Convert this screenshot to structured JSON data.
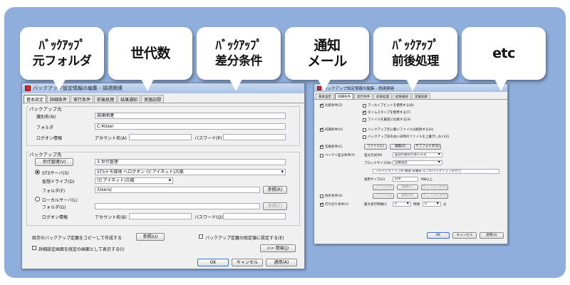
{
  "callouts": [
    {
      "line1": "ﾊﾞｯｸｱｯﾌﾟ",
      "line2": "元フォルダ"
    },
    {
      "line1": "世代数",
      "line2": ""
    },
    {
      "line1": "ﾊﾞｯｸｱｯﾌﾟ",
      "line2": "差分条件"
    },
    {
      "line1": "通知",
      "line2": "メール"
    },
    {
      "line1": "ﾊﾞｯｸｱｯﾌﾟ",
      "line2": "前後処理"
    },
    {
      "line1": "etc",
      "line2": ""
    }
  ],
  "left_window": {
    "title": "バックアップ設定情報の編集 - 調達関連",
    "tabs": [
      "基本設定",
      "詳細条件",
      "実行条件",
      "前後処理",
      "結果通知",
      "実施記録"
    ],
    "source_section": "バックアップ元",
    "id_label": "識別名(N)",
    "id_value": "調達関連",
    "folder_label": "フォルダ",
    "folder_value": "C:¥User",
    "logon_label": "ログオン情報",
    "account_label": "アカウント名(A)",
    "password_label": "パスワード(P)",
    "dest_section": "バックアップ先",
    "gen_button": "世代管理(V)",
    "gen_value": "3 世代管理",
    "sts_label": "STSサーバ(S)",
    "sts_value": "STSデモ環境 へログオン (ビアイネット)古橋",
    "vdrive_label": "仮想ドライブ(D)",
    "vdrive_value": "(ビアイネット)古橋",
    "dest_folder_label": "フォルダ(F)",
    "dest_folder_value": "/Users/",
    "browse_button": "参照(R)",
    "local_label": "ローカルサーバ(L)",
    "local_folder_label": "フォルダ(G)",
    "browse2_button": "参照(T)",
    "logon2_label": "ログオン情報",
    "account2_label": "アカウント名(B)",
    "password2_label": "パスワード(Q)",
    "copy_label": "既存のバックアップ定義をコピーして作成する",
    "copy_button": "参照(U)",
    "default_label": "バックアップ定義の既定値に設定する(E)",
    "detail_label": "詳細設定画面を既定の画面として表示する(I)",
    "simple_button": ">> 簡易(J)",
    "ok": "OK",
    "cancel": "キャンセル",
    "apply": "適用(A)"
  },
  "right_window": {
    "title": "バックアップ設定情報の編集 - 調達関連",
    "tabs": [
      "基本設定",
      "詳細条件",
      "実行条件",
      "前後処理",
      "結果通知",
      "実施記録"
    ],
    "compare_label": "比較条件(Z)",
    "archive_label": "アーカイブビットを使用する(B)",
    "timestamp_label": "タイムスタンプを使用する(T)",
    "content_label": "ファイルを厳密に比較する(S)",
    "sync_label": "同期条件(O)",
    "sync1_label": "バックアップ元に無いファイルは削除する(H)",
    "sync2_label": "バックアップ先の古い日時のファイルを上書きしない(E)",
    "exclude_label": "圧縮条件(C)",
    "file_button": "ファイル(L)",
    "edit_button": "編集(K)",
    "subfolder_button": "サブフォルダ(Q)",
    "binary_label": "バイナリ差分条件(Y)",
    "method_label": "差分方式(M)",
    "method_value": "差分の部分が多い方を",
    "block_label": "ブロックサイズ(N)",
    "block_value": "自動設定",
    "full_path_value": "フルバックアップの 毎週 日曜日 にフルバックアップを行う",
    "apply_size_label": "適用サイズ(G)",
    "apply_size_value": "100",
    "apply_size_unit": "MB以上",
    "file2_button": "ファイル(P)",
    "edit2_button": "編集(F)",
    "subfolder2_button": "サブフォルダ(R)",
    "exclude2_label": "除外条件(X)",
    "file3_button": "ファイル(U)",
    "edit3_button": "編集(W)",
    "subfolder3_button": "サブフォルダ(V)",
    "timeout_label": "打ち切り条件(Y)",
    "max_label": "最大実行時間(I)",
    "max_value": "4",
    "hour_label": "時間",
    "min_value": "0",
    "min_label": "分",
    "ok": "OK",
    "cancel": "キャンセル",
    "apply": "適用(A)"
  }
}
